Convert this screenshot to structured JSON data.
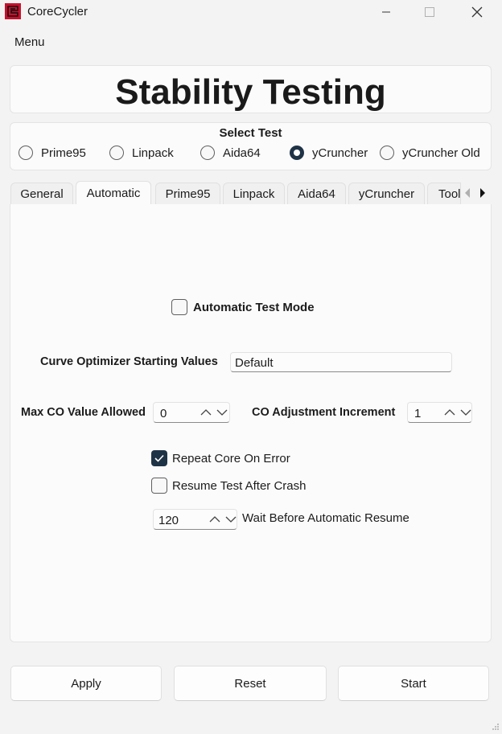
{
  "window": {
    "title": "CoreCycler"
  },
  "menu": {
    "label": "Menu"
  },
  "header": {
    "title": "Stability Testing"
  },
  "select_test": {
    "title": "Select Test",
    "options": [
      {
        "label": "Prime95",
        "checked": false
      },
      {
        "label": "Linpack",
        "checked": false
      },
      {
        "label": "Aida64",
        "checked": false
      },
      {
        "label": "yCruncher",
        "checked": true
      },
      {
        "label": "yCruncher Old",
        "checked": false
      }
    ]
  },
  "tabs": [
    {
      "label": "General",
      "active": false
    },
    {
      "label": "Automatic",
      "active": true
    },
    {
      "label": "Prime95",
      "active": false
    },
    {
      "label": "Linpack",
      "active": false
    },
    {
      "label": "Aida64",
      "active": false
    },
    {
      "label": "yCruncher",
      "active": false
    },
    {
      "label": "Tool",
      "active": false
    }
  ],
  "automatic": {
    "test_mode_label": "Automatic Test Mode",
    "test_mode_checked": false,
    "curve_optimizer_label": "Curve Optimizer Starting Values",
    "curve_optimizer_value": "Default",
    "max_co_label": "Max CO Value Allowed",
    "max_co_value": "0",
    "co_increment_label": "CO Adjustment Increment",
    "co_increment_value": "1",
    "repeat_core_label": "Repeat Core On Error",
    "repeat_core_checked": true,
    "resume_after_crash_label": "Resume Test After Crash",
    "resume_after_crash_checked": false,
    "wait_value": "120",
    "wait_label": "Wait Before Automatic Resume"
  },
  "buttons": {
    "apply": "Apply",
    "reset": "Reset",
    "start": "Start"
  },
  "colors": {
    "accent": "#1f3347",
    "app_icon": "#c8102e"
  }
}
